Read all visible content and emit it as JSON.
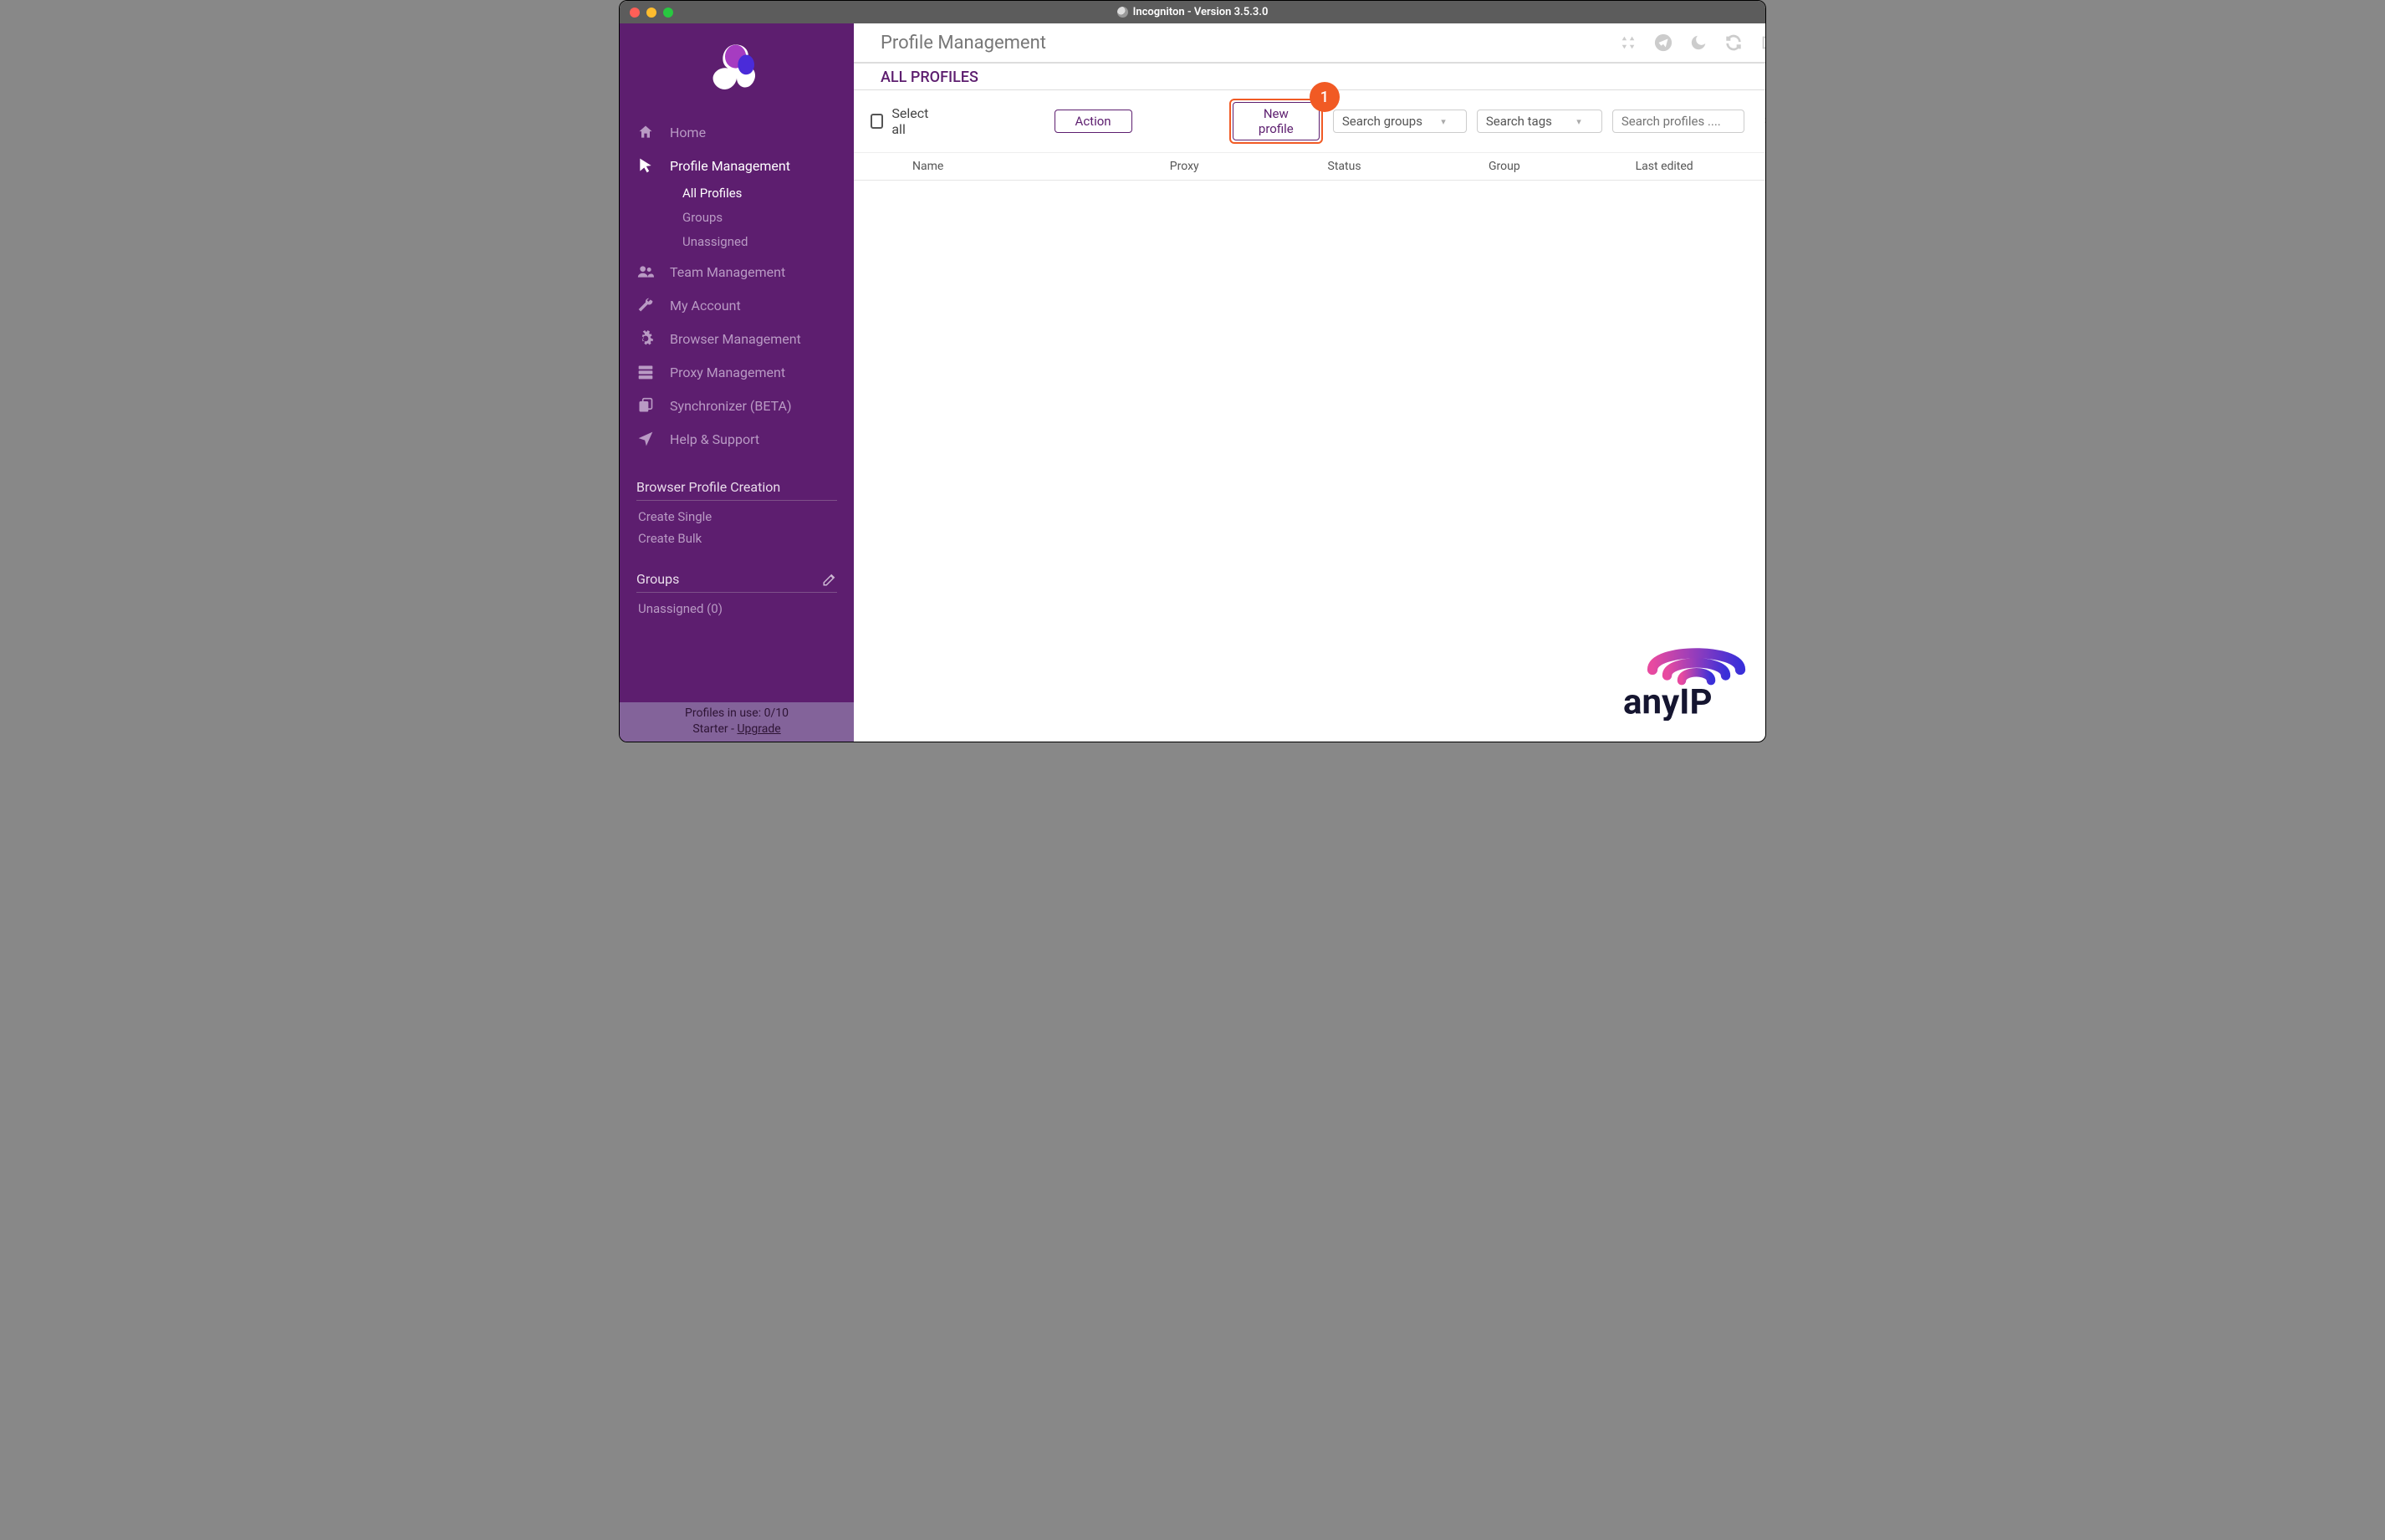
{
  "window": {
    "title": "Incogniton - Version 3.5.3.0"
  },
  "sidebar": {
    "nav": [
      {
        "label": "Home",
        "icon": "home-icon"
      },
      {
        "label": "Profile Management",
        "icon": "cursor-icon"
      },
      {
        "label": "Team Management",
        "icon": "users-icon"
      },
      {
        "label": "My Account",
        "icon": "wrench-icon"
      },
      {
        "label": "Browser Management",
        "icon": "cog-icon"
      },
      {
        "label": "Proxy Management",
        "icon": "server-icon"
      },
      {
        "label": "Synchronizer (BETA)",
        "icon": "copy-icon"
      },
      {
        "label": "Help & Support",
        "icon": "location-arrow-icon"
      }
    ],
    "profile_sub": [
      {
        "label": "All Profiles",
        "active": true
      },
      {
        "label": "Groups"
      },
      {
        "label": "Unassigned"
      }
    ],
    "sections": {
      "creation_header": "Browser Profile Creation",
      "creation_links": [
        "Create Single",
        "Create Bulk"
      ],
      "groups_header": "Groups",
      "groups_items": [
        "Unassigned (0)"
      ]
    }
  },
  "statusbar": {
    "line1_prefix": "Profiles in use:  ",
    "line1_value": "0/10",
    "line2_prefix": "Starter - ",
    "line2_link": "Upgrade"
  },
  "main": {
    "title": "Profile Management",
    "subtitle": "ALL PROFILES",
    "select_all_label": "Select all",
    "action_button": "Action",
    "new_profile_button": "New profile",
    "search_groups_placeholder": "Search groups",
    "search_tags_placeholder": "Search tags",
    "search_profiles_placeholder": "Search profiles ....",
    "callout_number": "1",
    "columns": [
      "Name",
      "Proxy",
      "Status",
      "Group",
      "Last edited"
    ]
  },
  "watermark": {
    "text": "anyIP"
  }
}
